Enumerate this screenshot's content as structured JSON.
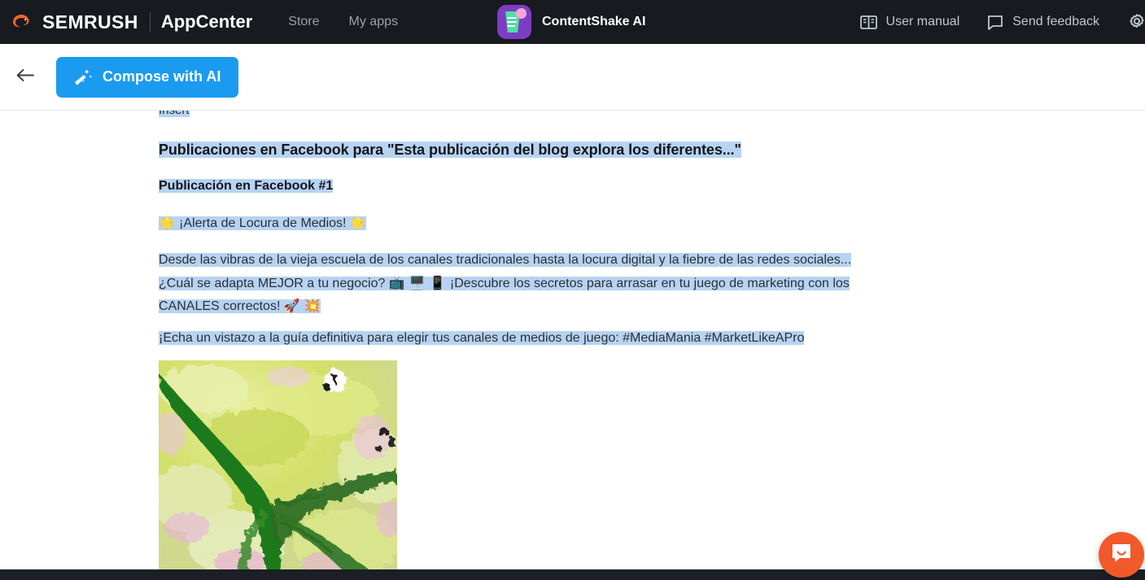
{
  "header": {
    "brand": "SEMRUSH",
    "product": "AppCenter",
    "nav": [
      {
        "label": "Store",
        "name": "nav-store"
      },
      {
        "label": "My apps",
        "name": "nav-my-apps"
      }
    ],
    "app": {
      "name": "ContentShake AI",
      "icon": "contentshake-app-icon",
      "icon_bg": "#7d3cc4",
      "icon_doc": "#4fe0a0",
      "icon_dot": "#f6a7d8"
    },
    "right_items": [
      {
        "label": "User manual",
        "icon": "book-icon",
        "name": "user-manual-link"
      },
      {
        "label": "Send feedback",
        "icon": "speech-bubble-icon",
        "name": "send-feedback-link"
      }
    ],
    "settings_icon": "gear-icon",
    "background": "#171a1f"
  },
  "toolbar": {
    "back_label": "←",
    "back_icon": "arrow-left-icon",
    "compose_label": "Compose with AI",
    "compose_icon": "magic-wand-icon",
    "compose_color": "#1a9bf0"
  },
  "document": {
    "cut_off_text": "Insert",
    "heading": "Publicaciones en Facebook para \"Esta publicación del blog explora los diferentes...\"",
    "subheading": "Publicación en Facebook #1",
    "alert_line": {
      "emoji_left": "🌟",
      "text": "¡Alerta de Locura de Medios!",
      "emoji_right": "🌟"
    },
    "body_line_1": "Desde las vibras de la vieja escuela de los canales tradicionales hasta la locura digital y la fiebre de las redes sociales...",
    "body_line_2_a": "¿Cuál se adapta MEJOR a tu negocio?",
    "body_emojis_mid": "📺 🖥️ 📱",
    "body_line_2_b": "¡Descubre los secretos para arrasar en tu juego de marketing con los",
    "body_line_3": "CANALES correctos!",
    "body_emojis_end": "🚀 💥",
    "cta_line": "¡Echa un vistazo a la guía definitiva para elegir tus canales de medios de juego: #MediaMania #MarketLikeAPro",
    "selection_color": "#b7d3f2",
    "image_alt": "satellite-river-delta-image"
  },
  "chat_widget": {
    "icon": "intercom-chat-icon",
    "color": "#f1592a"
  },
  "colors": {
    "header_bg": "#171a1f",
    "footer_bg": "#1b1f26",
    "accent_blue": "#1a9bf0",
    "semrush_orange": "#ff642d",
    "selection": "#b7d3f2"
  }
}
